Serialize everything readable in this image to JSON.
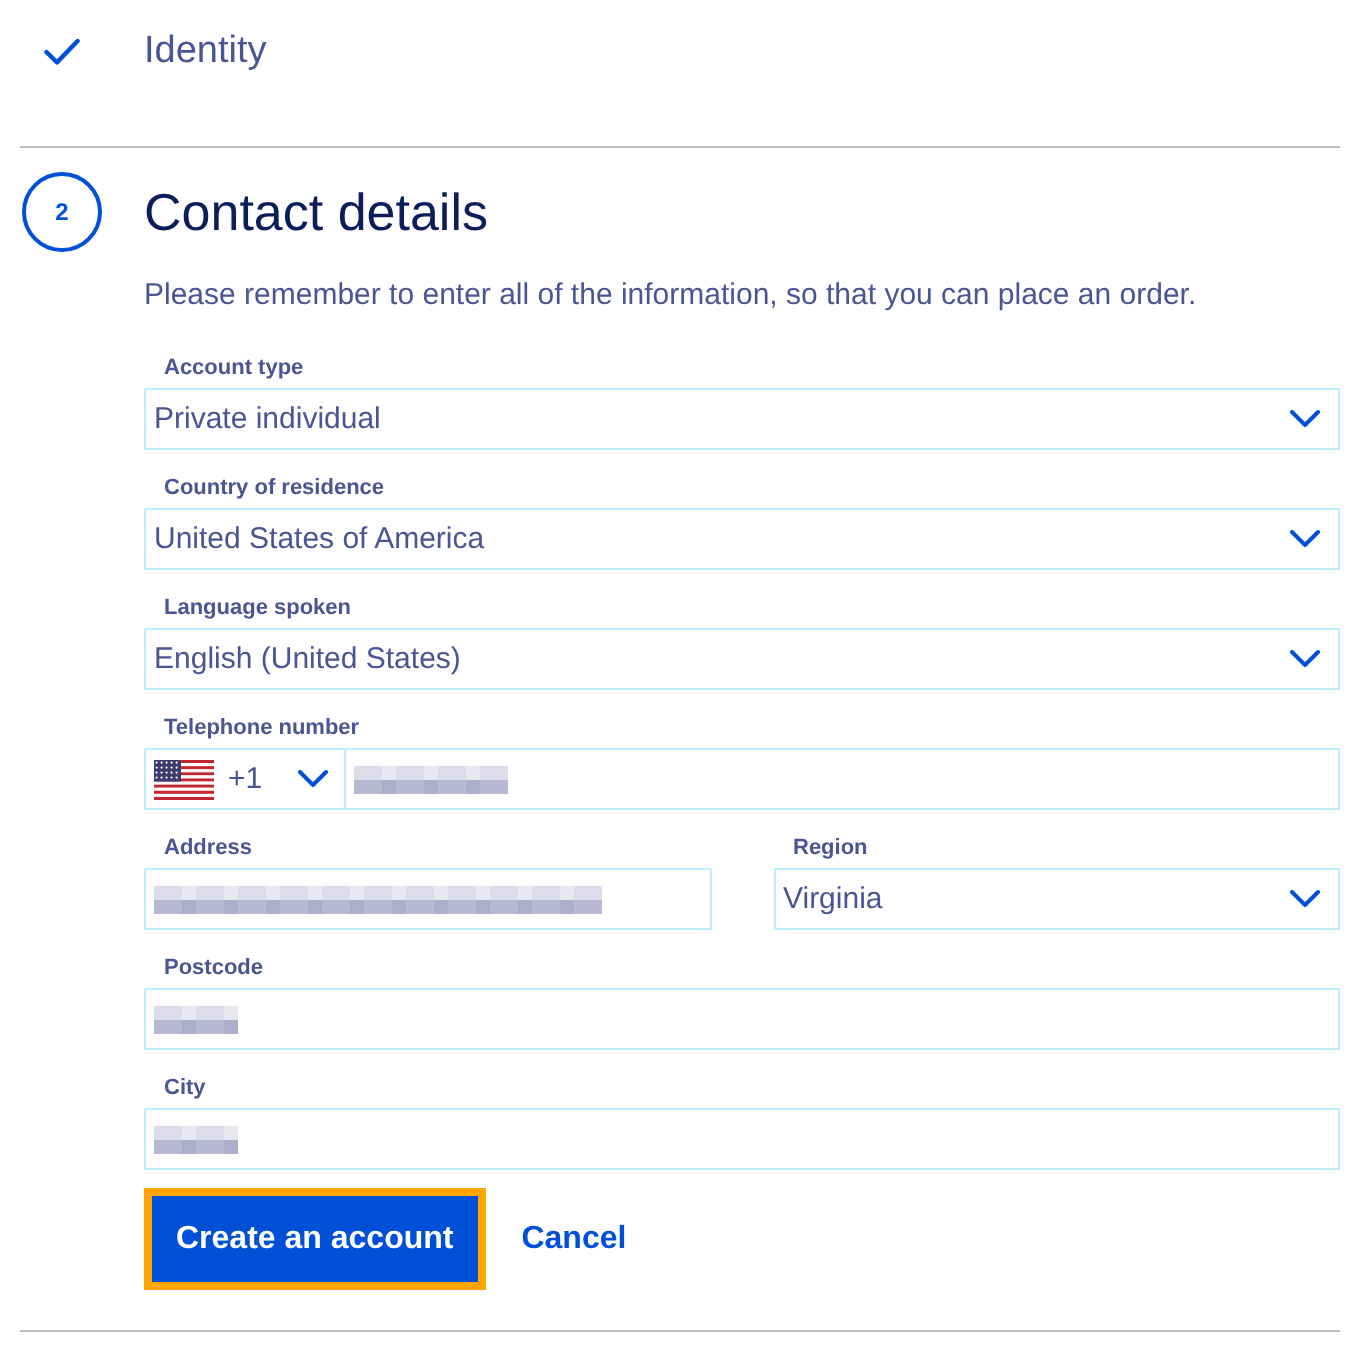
{
  "steps": [
    {
      "completed": true,
      "title": "Identity"
    },
    {
      "completed": false,
      "number": "2",
      "title": "Contact details",
      "description": "Please remember to enter all of the information, so that you can place an order.",
      "rows": [
        {
          "fields": [
            {
              "kind": "select",
              "label": "Account type",
              "value": "Private individual"
            }
          ]
        },
        {
          "fields": [
            {
              "kind": "select",
              "label": "Country of residence",
              "value": "United States of America"
            }
          ]
        },
        {
          "fields": [
            {
              "kind": "select",
              "label": "Language spoken",
              "value": "English (United States)"
            }
          ]
        },
        {
          "fields": [
            {
              "kind": "phone",
              "label": "Telephone number",
              "dial_code": "+1",
              "obscured": true
            }
          ]
        },
        {
          "fields": [
            {
              "kind": "text",
              "label": "Address",
              "obscured": true
            },
            {
              "kind": "select",
              "label": "Region",
              "value": "Virginia"
            }
          ]
        },
        {
          "fields": [
            {
              "kind": "text",
              "label": "Postcode",
              "obscured": true
            }
          ]
        },
        {
          "fields": [
            {
              "kind": "text",
              "label": "City",
              "obscured": true
            }
          ]
        }
      ],
      "buttons": [
        {
          "kind": "primary",
          "label": "Create an account",
          "focused": true
        },
        {
          "kind": "link",
          "label": "Cancel",
          "focused": false
        }
      ]
    }
  ]
}
